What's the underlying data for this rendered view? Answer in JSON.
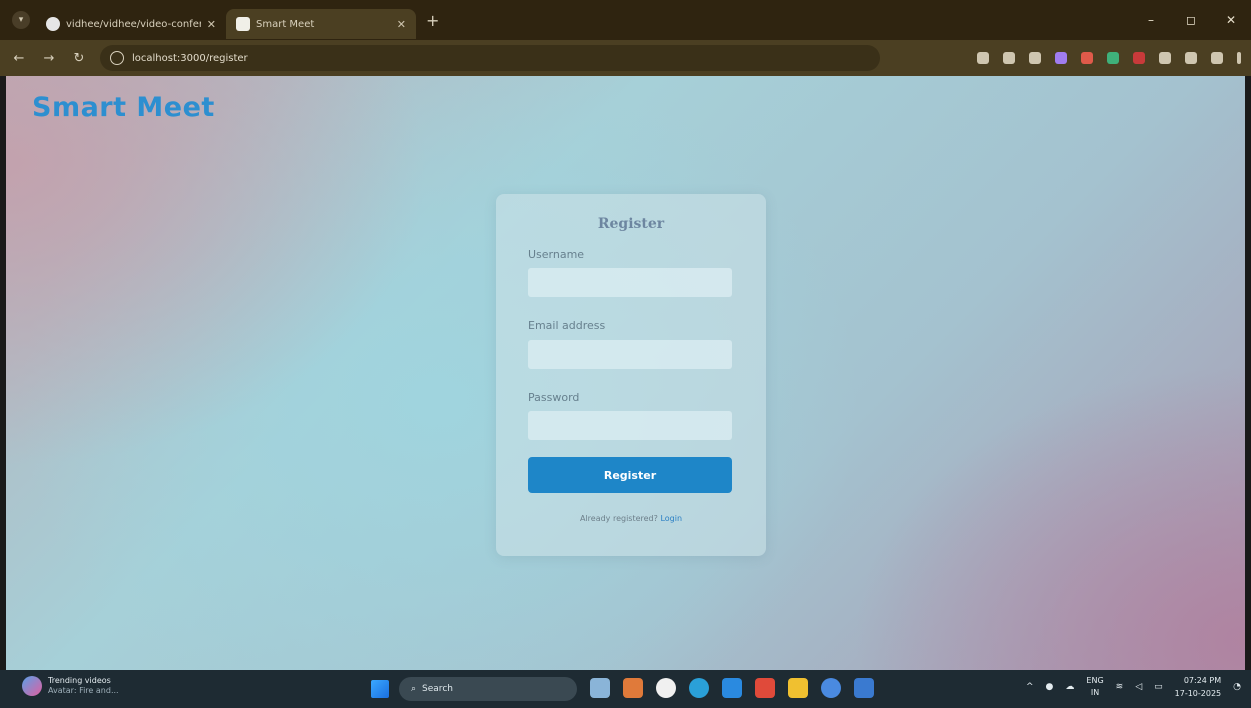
{
  "browser": {
    "tabs": [
      {
        "title": "vidhee/vidhee/video-conferen...",
        "active": false,
        "icon": "github-icon"
      },
      {
        "title": "Smart Meet",
        "active": true,
        "icon": "house-icon"
      }
    ],
    "new_tab_label": "+",
    "address": "localhost:3000/register",
    "window_controls": {
      "minimize": "–",
      "maximize": "◻",
      "close": "✕"
    }
  },
  "app": {
    "brand": "Smart Meet",
    "brand_color": "#2d8fd0",
    "form": {
      "title": "Register",
      "username_label": "Username",
      "username_value": "",
      "email_label": "Email address",
      "email_value": "",
      "password_label": "Password",
      "password_value": "",
      "submit_label": "Register",
      "submit_color": "#1e86c8",
      "footer_text": "Already registered?",
      "footer_link": "Login"
    }
  },
  "taskbar": {
    "widget_title": "Trending videos",
    "widget_subtitle": "Avatar: Fire and...",
    "search_placeholder": "Search",
    "language": "ENG",
    "region": "IN",
    "time": "07:24 PM",
    "date": "17-10-2025"
  }
}
